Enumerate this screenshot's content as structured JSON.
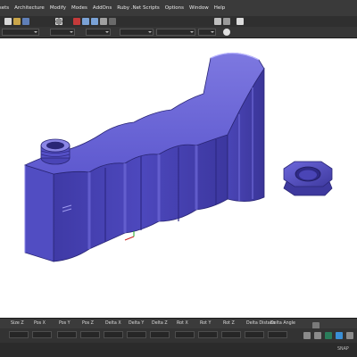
{
  "menu": {
    "items": [
      "ssets",
      "Architecture",
      "Modify",
      "Modes",
      "AddOns",
      "Ruby .Net Scripts",
      "Options",
      "Window",
      "Help"
    ]
  },
  "bottom": {
    "labels": [
      "Size Z",
      "Pos X",
      "Pos Y",
      "Pos Z",
      "Delta X",
      "Delta Y",
      "Delta Z",
      "Rot X",
      "Rot Y",
      "Rot Z",
      "Delta Distanc",
      "Delta Angle"
    ]
  },
  "status": {
    "right_text": "SNAP"
  },
  "colors": {
    "model_fill": "#5a54c8",
    "model_dark": "#2f2a86",
    "model_light": "#8b86e6",
    "highlight": "#b9b5ff",
    "chrome_dark": "#2b2b2b"
  },
  "icons": {
    "toolbar": [
      "document-icon",
      "folder-icon",
      "save-icon",
      "grid-icon",
      "close-icon",
      "undo-icon",
      "redo-icon",
      "cursor-icon",
      "select-icon",
      "chart-icon"
    ]
  }
}
